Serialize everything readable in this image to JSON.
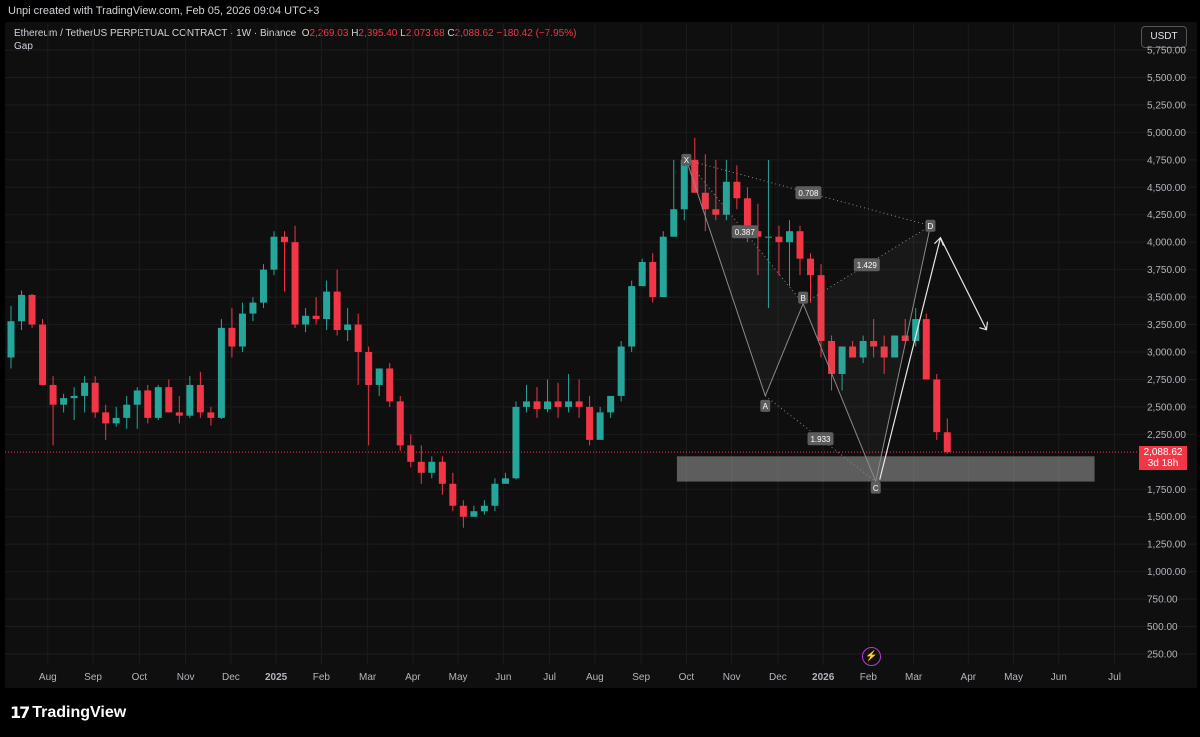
{
  "header": {
    "credit": "Unpi created with TradingView.com, Feb 05, 2026 09:04 UTC+3",
    "symbol": "Ethereum / TetherUS PERPETUAL CONTRACT · 1W · Binance",
    "ohlc": {
      "o_label": "O",
      "o": "2,269.03",
      "h_label": "H",
      "h": "2,395.40",
      "l_label": "L",
      "l": "2,073.68",
      "c_label": "C",
      "c": "2,088.62",
      "change": "−180.42 (−7.95%)"
    },
    "indicator": "Gap",
    "currency_button": "USDT"
  },
  "last_price": {
    "price": "2,088.62",
    "countdown": "3d 18h"
  },
  "branding": {
    "logo_text": "TradingView",
    "logo_mark": "17"
  },
  "colors": {
    "up": "#26a69a",
    "down": "#f23645",
    "background": "#0f0f0f",
    "pattern": "#8a8a8a",
    "zone": "#9e9e9e"
  },
  "event_icon": "lightning-icon",
  "chart_data": {
    "type": "candlestick",
    "y_axis_labels": [
      "5,750.00",
      "5,500.00",
      "5,250.00",
      "5,000.00",
      "4,750.00",
      "4,500.00",
      "4,250.00",
      "4,000.00",
      "3,750.00",
      "3,500.00",
      "3,250.00",
      "3,000.00",
      "2,750.00",
      "2,500.00",
      "2,250.00",
      "1,750.00",
      "1,500.00",
      "1,250.00",
      "1,000.00",
      "750.00",
      "500.00",
      "250.00"
    ],
    "y_values": [
      5750,
      5500,
      5250,
      5000,
      4750,
      4500,
      4250,
      4000,
      3750,
      3500,
      3250,
      3000,
      2750,
      2500,
      2250,
      1750,
      1500,
      1250,
      1000,
      750,
      500,
      250
    ],
    "x_axis_labels": [
      "Aug",
      "Sep",
      "Oct",
      "Nov",
      "Dec",
      "2025",
      "Feb",
      "Mar",
      "Apr",
      "May",
      "Jun",
      "Jul",
      "Aug",
      "Sep",
      "Oct",
      "Nov",
      "Dec",
      "2026",
      "Feb",
      "Mar",
      "Apr",
      "May",
      "Jun",
      "Jul"
    ],
    "x_label_index": [
      3.5,
      7.8,
      12.2,
      16.6,
      20.9,
      25.2,
      29.5,
      33.9,
      38.2,
      42.5,
      46.8,
      51.2,
      55.5,
      59.9,
      64.2,
      68.5,
      72.9,
      77.2,
      81.5,
      85.8,
      91,
      95.3,
      99.6,
      104.9
    ],
    "candles": [
      [
        2950,
        3420,
        2850,
        3280
      ],
      [
        3280,
        3560,
        3200,
        3520
      ],
      [
        3520,
        3530,
        3220,
        3250
      ],
      [
        3250,
        3300,
        2700,
        2700
      ],
      [
        2700,
        2780,
        2150,
        2520
      ],
      [
        2520,
        2620,
        2450,
        2580
      ],
      [
        2580,
        2680,
        2380,
        2600
      ],
      [
        2600,
        2780,
        2450,
        2720
      ],
      [
        2720,
        2780,
        2400,
        2450
      ],
      [
        2450,
        2520,
        2200,
        2350
      ],
      [
        2350,
        2500,
        2320,
        2400
      ],
      [
        2400,
        2600,
        2300,
        2520
      ],
      [
        2520,
        2680,
        2300,
        2650
      ],
      [
        2650,
        2700,
        2350,
        2400
      ],
      [
        2400,
        2700,
        2380,
        2680
      ],
      [
        2680,
        2750,
        2450,
        2450
      ],
      [
        2450,
        2600,
        2350,
        2420
      ],
      [
        2420,
        2780,
        2400,
        2700
      ],
      [
        2700,
        2820,
        2400,
        2450
      ],
      [
        2450,
        2500,
        2330,
        2400
      ],
      [
        2400,
        3300,
        2390,
        3220
      ],
      [
        3220,
        3400,
        2950,
        3050
      ],
      [
        3050,
        3450,
        3000,
        3350
      ],
      [
        3350,
        3500,
        3280,
        3450
      ],
      [
        3450,
        3800,
        3400,
        3750
      ],
      [
        3750,
        4100,
        3700,
        4050
      ],
      [
        4050,
        4100,
        3550,
        4000
      ],
      [
        4000,
        4150,
        3220,
        3250
      ],
      [
        3250,
        3400,
        3180,
        3330
      ],
      [
        3330,
        3500,
        3250,
        3300
      ],
      [
        3300,
        3650,
        3200,
        3550
      ],
      [
        3550,
        3750,
        3150,
        3200
      ],
      [
        3200,
        3400,
        3100,
        3250
      ],
      [
        3250,
        3350,
        2700,
        3000
      ],
      [
        3000,
        3050,
        2150,
        2700
      ],
      [
        2700,
        2850,
        2600,
        2850
      ],
      [
        2850,
        2900,
        2500,
        2550
      ],
      [
        2550,
        2600,
        2100,
        2150
      ],
      [
        2150,
        2250,
        1950,
        2000
      ],
      [
        2000,
        2150,
        1800,
        1900
      ],
      [
        1900,
        2050,
        1850,
        2000
      ],
      [
        2000,
        2050,
        1700,
        1800
      ],
      [
        1800,
        1900,
        1550,
        1600
      ],
      [
        1600,
        1650,
        1400,
        1500
      ],
      [
        1500,
        1600,
        1500,
        1550
      ],
      [
        1550,
        1650,
        1520,
        1600
      ],
      [
        1600,
        1850,
        1550,
        1800
      ],
      [
        1800,
        1900,
        1800,
        1850
      ],
      [
        1850,
        2550,
        1840,
        2500
      ],
      [
        2500,
        2700,
        2450,
        2550
      ],
      [
        2550,
        2680,
        2400,
        2480
      ],
      [
        2480,
        2750,
        2450,
        2550
      ],
      [
        2550,
        2720,
        2400,
        2500
      ],
      [
        2500,
        2800,
        2450,
        2550
      ],
      [
        2550,
        2750,
        2400,
        2500
      ],
      [
        2500,
        2600,
        2150,
        2200
      ],
      [
        2200,
        2500,
        2200,
        2450
      ],
      [
        2450,
        2550,
        2400,
        2600
      ],
      [
        2600,
        3100,
        2550,
        3050
      ],
      [
        3050,
        3650,
        3000,
        3600
      ],
      [
        3600,
        3850,
        3600,
        3820
      ],
      [
        3820,
        3900,
        3450,
        3500
      ],
      [
        3500,
        4100,
        3500,
        4050
      ],
      [
        4050,
        4750,
        4050,
        4300
      ],
      [
        4300,
        4800,
        4200,
        4750
      ],
      [
        4750,
        4950,
        4600,
        4450
      ],
      [
        4450,
        4800,
        4100,
        4300
      ],
      [
        4300,
        4750,
        4200,
        4250
      ],
      [
        4250,
        4750,
        4200,
        4550
      ],
      [
        4550,
        4700,
        4300,
        4400
      ],
      [
        4400,
        4500,
        4000,
        4100
      ],
      [
        4100,
        4350,
        3700,
        4050
      ],
      [
        4050,
        4750,
        3400,
        4050
      ],
      [
        4050,
        4150,
        3700,
        4000
      ],
      [
        4000,
        4200,
        3600,
        4100
      ],
      [
        4100,
        4150,
        3700,
        3850
      ],
      [
        3850,
        3900,
        3450,
        3700
      ],
      [
        3700,
        3800,
        2950,
        3100
      ],
      [
        3100,
        3150,
        2650,
        2800
      ],
      [
        2800,
        3050,
        2650,
        3050
      ],
      [
        3050,
        3100,
        2950,
        2950
      ],
      [
        2950,
        3150,
        2900,
        3100
      ],
      [
        3100,
        3300,
        2950,
        3050
      ],
      [
        3050,
        3150,
        2800,
        2950
      ],
      [
        2950,
        3150,
        2950,
        3150
      ],
      [
        3150,
        3300,
        3100,
        3100
      ],
      [
        3100,
        3400,
        3050,
        3300
      ],
      [
        3300,
        3350,
        2950,
        2750
      ],
      [
        2750,
        2800,
        2200,
        2270
      ],
      [
        2269.03,
        2395.4,
        2073.68,
        2088.62
      ]
    ],
    "candle_x_offset": 0,
    "last_price_value": 2088.62,
    "pattern_points": [
      {
        "label": "X",
        "index": 64.2,
        "price": 4750
      },
      {
        "label": "A",
        "index": 71.7,
        "price": 2600
      },
      {
        "label": "B",
        "index": 75.3,
        "price": 3440
      },
      {
        "label": "C",
        "index": 82.2,
        "price": 1820
      },
      {
        "label": "D",
        "index": 87.4,
        "price": 4150
      }
    ],
    "ratios": [
      {
        "value": "0.387",
        "between": [
          "X",
          "B"
        ]
      },
      {
        "value": "0.708",
        "between": [
          "X",
          "D"
        ]
      },
      {
        "value": "1.429",
        "between": [
          "B",
          "D"
        ]
      },
      {
        "value": "1.933",
        "between": [
          "A",
          "C"
        ]
      }
    ],
    "zone": {
      "price_top": 2050,
      "price_bottom": 1820,
      "from_index": 63.3,
      "to_index": 103
    }
  }
}
